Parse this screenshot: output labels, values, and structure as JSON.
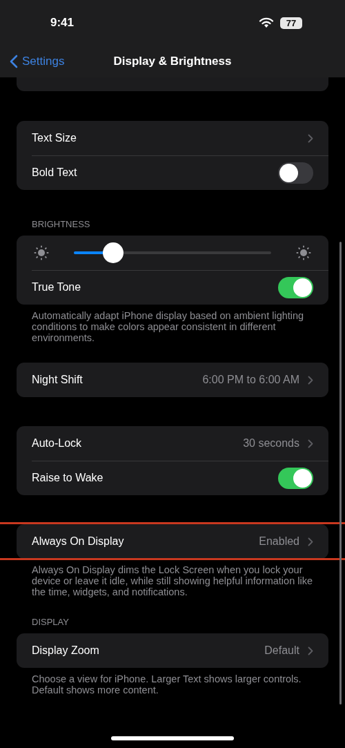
{
  "status_bar": {
    "time": "9:41",
    "battery": "77"
  },
  "nav": {
    "back": "Settings",
    "title": "Display & Brightness"
  },
  "groups": [
    {
      "rows": [
        {
          "kind": "link",
          "label": "Text Size"
        },
        {
          "kind": "toggle",
          "label": "Bold Text",
          "on": false
        }
      ]
    },
    {
      "header": "BRIGHTNESS",
      "rows": [
        {
          "kind": "slider",
          "level": 0.2
        },
        {
          "kind": "toggle",
          "label": "True Tone",
          "on": true
        }
      ],
      "footer": "Automatically adapt iPhone display based on ambient lighting conditions to make colors appear consistent in different environments."
    },
    {
      "rows": [
        {
          "kind": "link",
          "label": "Night Shift",
          "value": "6:00 PM to 6:00 AM"
        }
      ]
    },
    {
      "rows": [
        {
          "kind": "link",
          "label": "Auto-Lock",
          "value": "30 seconds"
        },
        {
          "kind": "toggle",
          "label": "Raise to Wake",
          "on": true
        }
      ]
    },
    {
      "highlighted": true,
      "rows": [
        {
          "kind": "link",
          "label": "Always On Display",
          "value": "Enabled"
        }
      ],
      "footer": "Always On Display dims the Lock Screen when you lock your device or leave it idle, while still showing helpful information like the time, widgets, and notifications."
    },
    {
      "header": "DISPLAY",
      "rows": [
        {
          "kind": "link",
          "label": "Display Zoom",
          "value": "Default"
        }
      ],
      "footer": "Choose a view for iPhone. Larger Text shows larger controls. Default shows more content."
    }
  ]
}
